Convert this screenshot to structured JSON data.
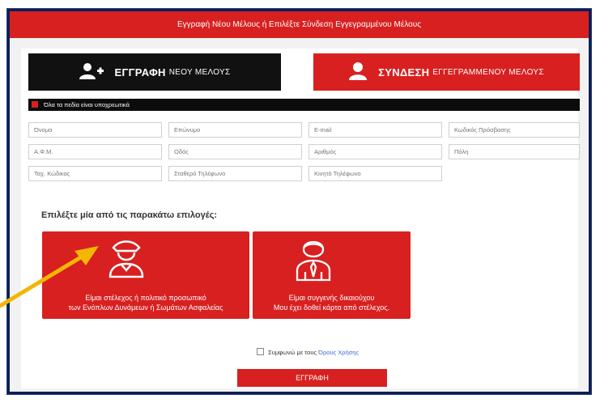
{
  "header": {
    "title": "Εγγραφή Νέου Μέλους ή Επιλέξτε Σύνδεση Εγγεγραμμένου Μέλους"
  },
  "tabs": {
    "register": {
      "bold": "ΕΓΓΡΑΦΗ",
      "rest": "ΝΕΟΥ ΜΕΛΟΥΣ"
    },
    "login": {
      "bold": "ΣΥΝΔΕΣΗ",
      "rest": "ΕΓΓΕΓΡΑΜΜΕΝΟΥ ΜΕΛΟΥΣ"
    }
  },
  "required_note": "Όλα τα πεδία είναι υποχρεωτικά",
  "fields": {
    "name": "Όνομα",
    "surname": "Επώνυμο",
    "email": "E-mail",
    "password": "Κωδικός Πρόσβασης",
    "afm": "Α.Φ.Μ.",
    "address": "Οδός",
    "number": "Αριθμός",
    "city": "Πόλη",
    "postal_code": "Ταχ. Κώδικας",
    "landline": "Σταθερό Τηλέφωνο",
    "mobile": "Κινητό Τηλέφωνο"
  },
  "prompt": "Επιλέξτε μία από τις παρακάτω επιλογές:",
  "option1": {
    "line1": "Είμαι στέλεχος ή πολιτικό προσωπικό",
    "line2": "των Ενόπλων Δυνάμεων ή Σωμάτων Ασφαλείας"
  },
  "option2": {
    "line1": "Είμαι συγγενής δικαιούχου",
    "line2": "Μου έχει δοθεί κάρτα από στέλεχος."
  },
  "terms": {
    "prefix": "Συμφωνώ με τους",
    "link": "Όρους Χρήσης"
  },
  "submit_label": "ΕΓΓΡΑΦΗ",
  "colors": {
    "accent": "#d82020",
    "dark": "#111111",
    "frame": "#0b1f55",
    "arrow": "#f2b705"
  }
}
